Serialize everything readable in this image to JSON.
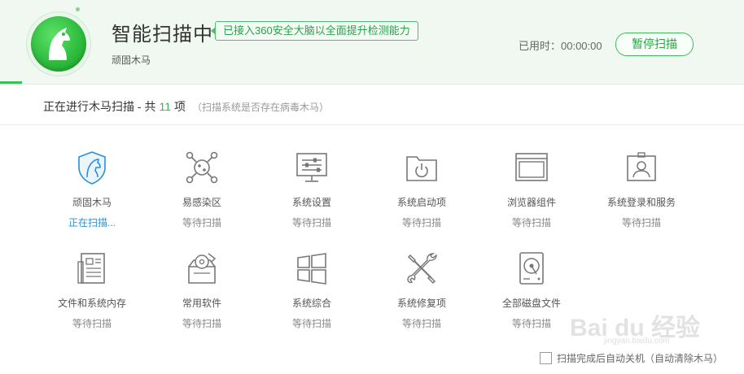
{
  "header": {
    "title": "智能扫描中",
    "badge": "已接入360安全大脑以全面提升检测能力",
    "subtitle": "顽固木马",
    "elapsed_label": "已用时：00:00:00",
    "pause_button": "暂停扫描",
    "progress": 0.03
  },
  "summary": {
    "prefix": "正在进行木马扫描 - 共",
    "count": "11",
    "suffix": "项",
    "hint": "（扫描系统是否存在病毒木马）"
  },
  "items": [
    {
      "name": "顽固木马",
      "status": "正在扫描...",
      "icon": "shield-horse-icon"
    },
    {
      "name": "易感染区",
      "status": "等待扫描",
      "icon": "virus-icon"
    },
    {
      "name": "系统设置",
      "status": "等待扫描",
      "icon": "settings-panel-icon"
    },
    {
      "name": "系统启动项",
      "status": "等待扫描",
      "icon": "power-folder-icon"
    },
    {
      "name": "浏览器组件",
      "status": "等待扫描",
      "icon": "browser-window-icon"
    },
    {
      "name": "系统登录和服务",
      "status": "等待扫描",
      "icon": "user-badge-icon"
    },
    {
      "name": "文件和系统内存",
      "status": "等待扫描",
      "icon": "document-icon"
    },
    {
      "name": "常用软件",
      "status": "等待扫描",
      "icon": "software-box-icon"
    },
    {
      "name": "系统综合",
      "status": "等待扫描",
      "icon": "windows-logo-icon"
    },
    {
      "name": "系统修复项",
      "status": "等待扫描",
      "icon": "tools-icon"
    },
    {
      "name": "全部磁盘文件",
      "status": "等待扫描",
      "icon": "hard-disk-icon"
    }
  ],
  "footer": {
    "checkbox_label": "扫描完成后自动关机（自动清除木马）",
    "checked": false
  },
  "watermark": {
    "text": "Bai du 经验",
    "url": "jingyan.baidu.com"
  },
  "colors": {
    "accent_green": "#36b84d",
    "active_blue": "#2a8fe0",
    "header_bg": "#f1f8f2"
  }
}
